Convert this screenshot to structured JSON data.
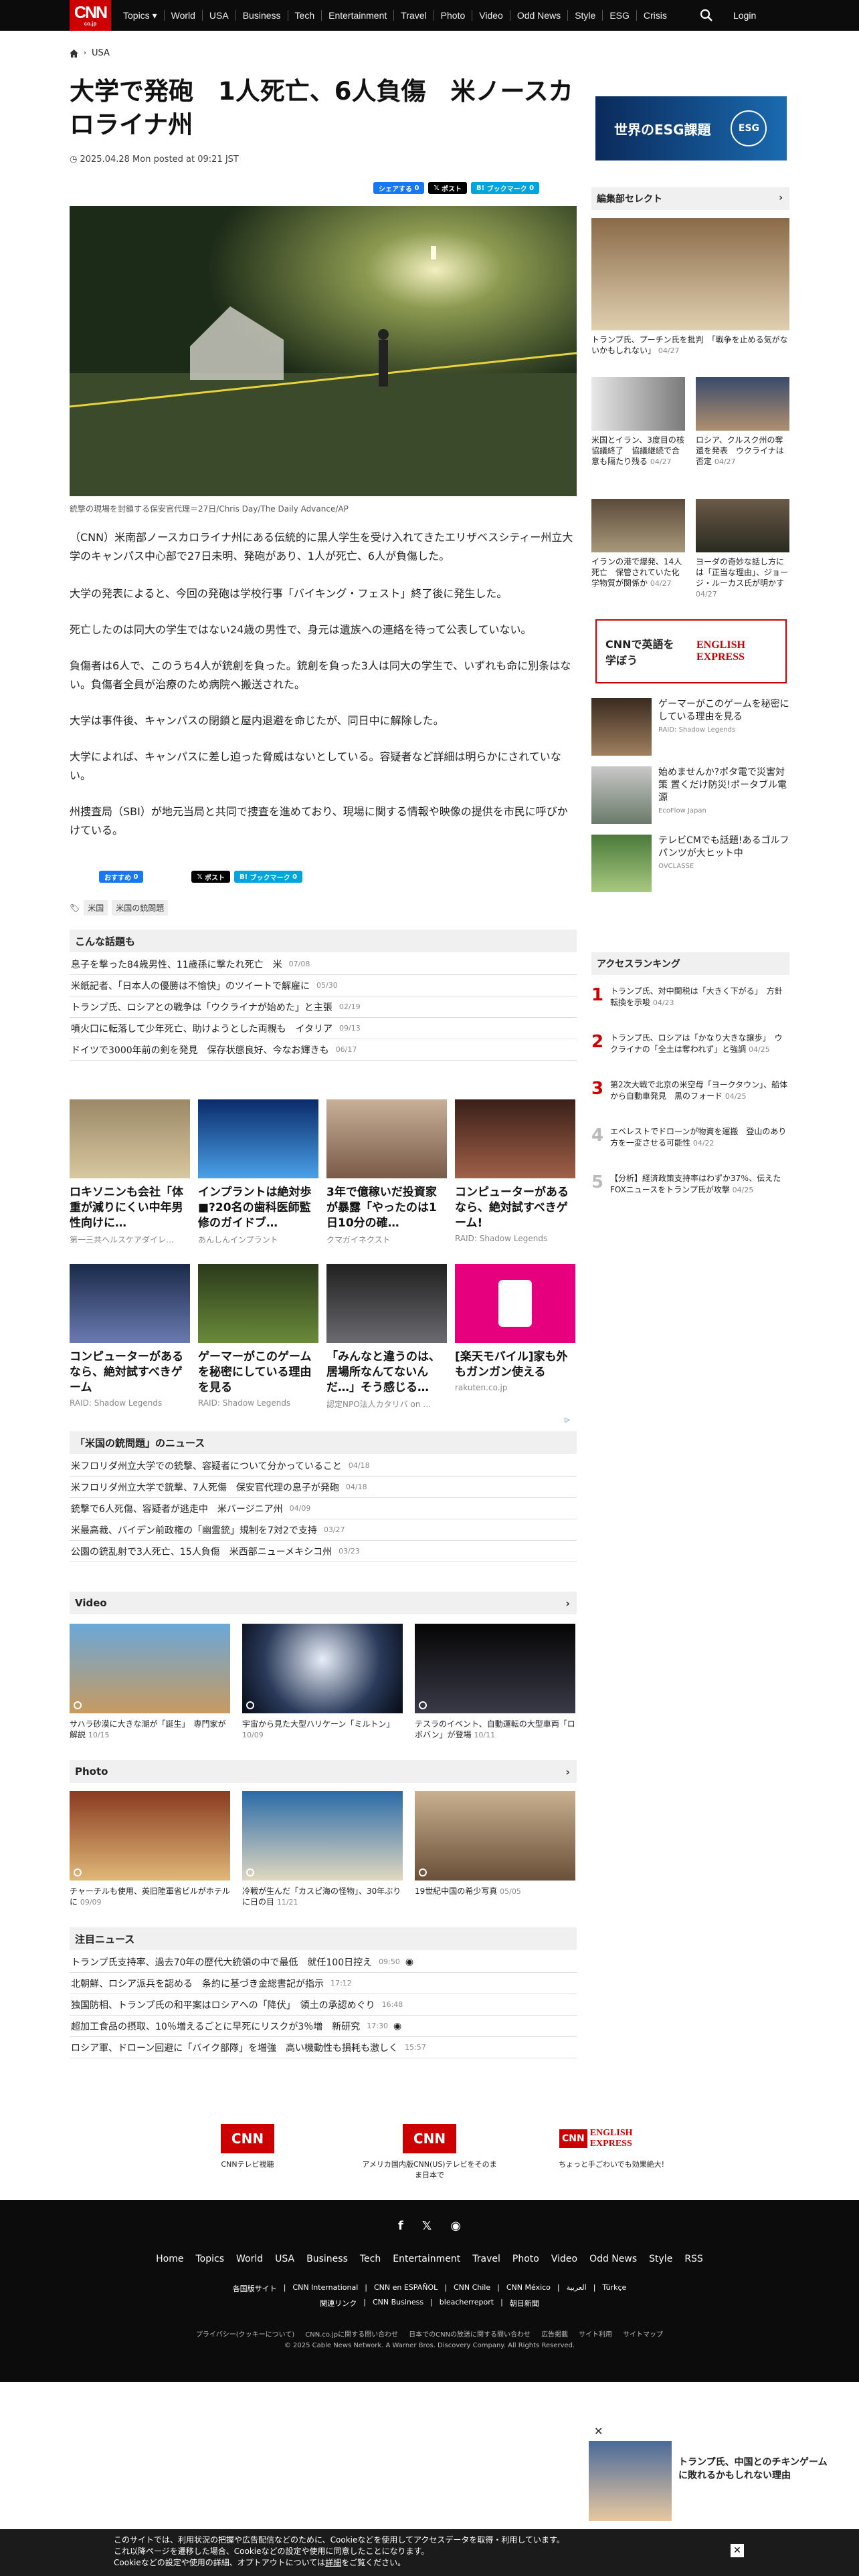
{
  "nav": {
    "logo": "CNN",
    "logo_sub": "co.jp",
    "items": [
      "Topics",
      "World",
      "USA",
      "Business",
      "Tech",
      "Entertainment",
      "Travel",
      "Photo",
      "Video",
      "Odd News",
      "Style",
      "ESG",
      "Crisis"
    ],
    "login": "Login"
  },
  "breadcrumb": {
    "section": "USA"
  },
  "article": {
    "title": "大学で発砲　1人死亡、6人負傷　米ノースカロライナ州",
    "date": "2025.04.28 Mon posted at 09:21 JST",
    "share_fb": "シェアする",
    "share_fb_count": "0",
    "share_x": "ポスト",
    "share_hatena": "ブックマーク",
    "share_hatena_count": "0",
    "caption": "銃撃の現場を封鎖する保安官代理＝27日/Chris Day/The Daily Advance/AP",
    "paragraphs": [
      "（CNN）米南部ノースカロライナ州にある伝統的に黒人学生を受け入れてきたエリザベスシティー州立大学のキャンパス中心部で27日未明、発砲があり、1人が死亡、6人が負傷した。",
      "大学の発表によると、今回の発砲は学校行事「バイキング・フェスト」終了後に発生した。",
      "死亡したのは同大の学生ではない24歳の男性で、身元は遺族への連絡を待って公表していない。",
      "負傷者は6人で、このうち4人が銃創を負った。銃創を負った3人は同大の学生で、いずれも命に別条はない。負傷者全員が治療のため病院へ搬送された。",
      "大学は事件後、キャンパスの閉鎖と屋内退避を命じたが、同日中に解除した。",
      "大学によれば、キャンパスに差し迫った脅威はないとしている。容疑者など詳細は明らかにされていない。",
      "州捜査局（SBI）が地元当局と共同で捜査を進めており、現場に関する情報や映像の提供を市民に呼びかけている。"
    ],
    "share2_fb": "おすすめ",
    "share2_fb_count": "0",
    "share2_x": "ポスト",
    "share2_hatena": "ブックマーク",
    "share2_hatena_count": "0",
    "tags": [
      "米国",
      "米国の銃問題"
    ]
  },
  "popular": {
    "heading": "こんな話題も",
    "items": [
      {
        "t": "息子を撃った84歳男性、11歳孫に撃たれ死亡　米",
        "d": "07/08"
      },
      {
        "t": "米紙記者、「日本人の優勝は不愉快」のツイートで解雇に",
        "d": "05/30"
      },
      {
        "t": "トランプ氏、ロシアとの戦争は「ウクライナが始めた」と主張",
        "d": "02/19"
      },
      {
        "t": "噴火口に転落して少年死亡、助けようとした両親も　イタリア",
        "d": "09/13"
      },
      {
        "t": "ドイツで3000年前の剣を発見　保存状態良好、今なお輝きも",
        "d": "06/17"
      }
    ]
  },
  "ads": [
    {
      "t": "ロキソニンも会社「体重が減りにくい中年男性向けに…",
      "s": "第一三共ヘルスケアダイレ…"
    },
    {
      "t": "インプラントは絶対歩■?20名の歯科医師監修のガイドブ…",
      "s": "あんしんインプラント"
    },
    {
      "t": "3年で億稼いだ投資家が暴露「やったのは1日10分の確…",
      "s": "クマガイネクスト"
    },
    {
      "t": "コンピューターがあるなら、絶対試すべきゲーム!",
      "s": "RAID: Shadow Legends"
    },
    {
      "t": "コンピューターがあるなら、絶対試すべきゲーム",
      "s": "RAID: Shadow Legends"
    },
    {
      "t": "ゲーマーがこのゲームを秘密にしている理由を見る",
      "s": "RAID: Shadow Legends"
    },
    {
      "t": "「みんなと違うのは、居場所なんてないんだ…」そう感じる…",
      "s": "認定NPO法人カタリバ on …"
    },
    {
      "t": "[楽天モバイル]家も外もガンガン使える",
      "s": "rakuten.co.jp"
    }
  ],
  "gun_news": {
    "heading": "「米国の銃問題」のニュース",
    "items": [
      {
        "t": "米フロリダ州立大学での銃撃、容疑者について分かっていること",
        "d": "04/18"
      },
      {
        "t": "米フロリダ州立大学で銃撃、7人死傷　保安官代理の息子が発砲",
        "d": "04/18"
      },
      {
        "t": "銃撃で6人死傷、容疑者が逃走中　米バージニア州",
        "d": "04/09"
      },
      {
        "t": "米最高裁、バイデン前政権の「幽霊銃」規制を7対2で支持",
        "d": "03/27"
      },
      {
        "t": "公園の銃乱射で3人死亡、15人負傷　米西部ニューメキシコ州",
        "d": "03/23"
      }
    ]
  },
  "video": {
    "heading": "Video",
    "items": [
      {
        "t": "サハラ砂漠に大きな湖が「誕生」　専門家が解説",
        "d": "10/15"
      },
      {
        "t": "宇宙から見た大型ハリケーン「ミルトン」",
        "d": "10/09"
      },
      {
        "t": "テスラのイベント、自動運転の大型車両「ロボバン」が登場",
        "d": "10/11"
      }
    ]
  },
  "photo": {
    "heading": "Photo",
    "items": [
      {
        "t": "チャーチルも使用、英旧陸軍省ビルがホテルに",
        "d": "09/09"
      },
      {
        "t": "冷戦が生んだ「カスピ海の怪物」、30年ぶりに日の目",
        "d": "11/21"
      },
      {
        "t": "19世紀中国の希少写真",
        "d": "05/05"
      }
    ]
  },
  "attention": {
    "heading": "注目ニュース",
    "items": [
      {
        "t": "トランプ氏支持率、過去70年の歴代大統領の中で最低　就任100日控え",
        "d": "09:50"
      },
      {
        "t": "北朝鮮、ロシア派兵を認める　条約に基づき金総書記が指示",
        "d": "17:12"
      },
      {
        "t": "独国防相、トランプ氏の和平案はロシアへの「降伏」　領土の承認めぐり",
        "d": "16:48"
      },
      {
        "t": "超加工食品の摂取、10％増えるごとに早死にリスクが3％増　新研究",
        "d": "17:30"
      },
      {
        "t": "ロシア軍、ドローン回避に「バイク部隊」を増強　高い機動性も損耗も激しく",
        "d": "15:57"
      }
    ]
  },
  "banners": [
    {
      "t": "CNNテレビ視聴"
    },
    {
      "t": "アメリカ国内版CNN(US)テレビをそのまま日本で"
    },
    {
      "t": "ちょっと手ごわいでも効果絶大!"
    }
  ],
  "side": {
    "esg_banner": "世界のESG課題",
    "esg_tag": "ESG",
    "picks_heading": "編集部セレクト",
    "picks": [
      {
        "t": "トランプ氏、プーチン氏を批判　「戦争を止める気がないかもしれない」",
        "d": "04/27"
      },
      {
        "t": "米国とイラン、3度目の核協議終了　協議継続で合意も隔たり残る",
        "d": "04/27"
      },
      {
        "t": "ロシア、クルスク州の奪還を発表　ウクライナは否定",
        "d": "04/27"
      },
      {
        "t": "イランの港で爆発、14人死亡　保管されていた化学物質が関係か",
        "d": "04/27"
      },
      {
        "t": "ヨーダの奇妙な話し方には「正当な理由」、ジョージ・ルーカス氏が明かす",
        "d": "04/27"
      }
    ],
    "english_banner": "CNNで英語を学ぼう",
    "english_logo": "ENGLISH EXPRESS",
    "promo": [
      {
        "t": "ゲーマーがこのゲームを秘密にしている理由を見る",
        "s": "RAID: Shadow Legends"
      },
      {
        "t": "始めませんか?ポタ電で災害対策 置くだけ防災!ポータブル電源",
        "s": "EcoFlow Japan"
      },
      {
        "t": "テレビCMでも話題!あるゴルフパンツが大ヒット中",
        "s": "OVCLASSE"
      }
    ],
    "ranking_heading": "アクセスランキング",
    "ranking": [
      {
        "n": "1",
        "t": "トランプ氏、対中関税は「大きく下がる」　方針転換を示唆",
        "d": "04/23"
      },
      {
        "n": "2",
        "t": "トランプ氏、ロシアは「かなり大きな譲歩」　ウクライナの「全土は奪われず」と強調",
        "d": "04/25"
      },
      {
        "n": "3",
        "t": "第2次大戦で北京の米空母「ヨークタウン」、船体から自動車発見　黒のフォード",
        "d": "04/25"
      },
      {
        "n": "4",
        "t": "エベレストでドローンが物資を運搬　登山のあり方を一変させる可能性",
        "d": "04/22"
      },
      {
        "n": "5",
        "t": "【分析】経済政策支持率はわずか37％、伝えたFOXニュースをトランプ氏が攻撃",
        "d": "04/25"
      }
    ]
  },
  "footer": {
    "nav": [
      "Home",
      "Topics",
      "World",
      "USA",
      "Business",
      "Tech",
      "Entertainment",
      "Travel",
      "Photo",
      "Video",
      "Odd News",
      "Style",
      "RSS"
    ],
    "row1": [
      "各国版サイト",
      "CNN International",
      "CNN en ESPAÑOL",
      "CNN Chile",
      "CNN México",
      "العربية",
      "Türkçe"
    ],
    "row2": [
      "関連リンク",
      "CNN Business",
      "bleacherreport",
      "朝日新聞"
    ],
    "row3": [
      "プライバシー(クッキーについて)",
      "CNN.co.jpに関する問い合わせ",
      "日本でのCNNの放送に関する問い合わせ",
      "広告掲載",
      "サイト利用",
      "サイトマップ"
    ],
    "copyright": "© 2025 Cable News Network. A Warner Bros. Discovery Company. All Rights Reserved."
  },
  "popup": {
    "t": "トランプ氏、中国とのチキンゲームに敗れるかもしれない理由"
  },
  "cookie": {
    "l1": "このサイトでは、利用状況の把握や広告配信などのために、Cookieなどを使用してアクセスデータを取得・利用しています。",
    "l2": "これ以降ページを遷移した場合、Cookieなどの設定や使用に同意したことになります。",
    "l3": "Cookieなどの設定や使用の詳細、オプトアウトについては",
    "link": "詳細",
    "l4": "をご覧ください。"
  }
}
